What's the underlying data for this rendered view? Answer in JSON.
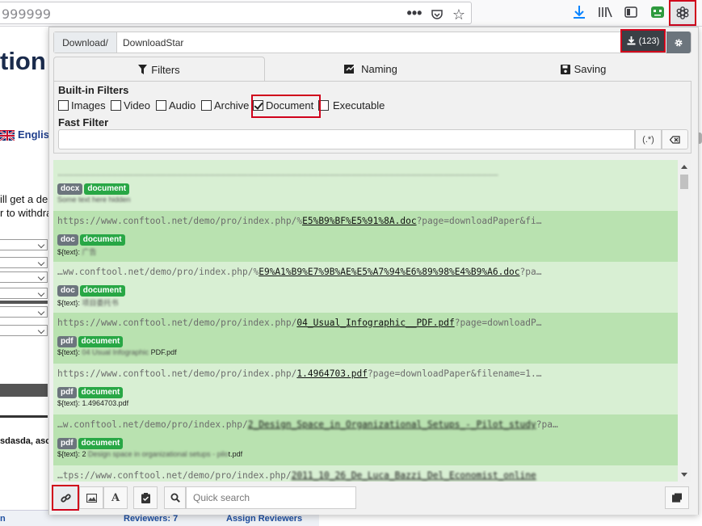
{
  "browser": {
    "url_partial": "999999",
    "icons": [
      "more-dots-icon",
      "pocket-icon",
      "bookmark-star-icon",
      "download-arrow-icon",
      "library-icon",
      "sidebar-icon",
      "addon-green-icon",
      "extension-gear-icon"
    ]
  },
  "background_page": {
    "heading_fragment": "tion",
    "language": "Englis",
    "text_line1": "ill get a de",
    "text_line2": "r to withdra",
    "user_fragment": "sdasda, asc",
    "reviewers_label": "Reviewers: 7",
    "assign_label": "Assign Reviewers",
    "link_fragment": "n"
  },
  "popup": {
    "path_prefix": "Download/",
    "path_value": "DownloadStar",
    "download_count": "(123)",
    "tabs": [
      {
        "label": "Filters",
        "icon": "filter-icon",
        "active": true
      },
      {
        "label": "Naming",
        "icon": "signature-icon",
        "active": false
      },
      {
        "label": "Saving",
        "icon": "floppy-disk-icon",
        "active": false
      }
    ],
    "builtin_filters_title": "Built-in Filters",
    "filters": [
      {
        "label": "Images",
        "checked": false
      },
      {
        "label": "Video",
        "checked": false
      },
      {
        "label": "Audio",
        "checked": false
      },
      {
        "label": "Archive",
        "checked": false
      },
      {
        "label": "Document",
        "checked": true
      },
      {
        "label": "Executable",
        "checked": false
      }
    ],
    "fast_filter_title": "Fast Filter",
    "fast_filter_value": "",
    "regex_label": "(.*)",
    "items": [
      {
        "url_prefix": "",
        "file": "",
        "url_suffix": "",
        "url_blurred": "_________________________________________________________________________________",
        "type": "docx",
        "category": "document",
        "text_prefix": "",
        "text_blurred": "Some text here hidden"
      },
      {
        "url_prefix": "https://www.conftool.net/demo/pro/index.php/%",
        "file": "E5%B9%BF%E5%91%8A.doc",
        "url_suffix": "?page=downloadPaper&fi…",
        "url_blurred": "",
        "type": "doc",
        "category": "document",
        "text_prefix": "${text}: ",
        "text_blurred": "广告"
      },
      {
        "url_prefix": "…ww.conftool.net/demo/pro/index.php/%",
        "file": "E9%A1%B9%E7%9B%AE%E5%A7%94%E6%89%98%E4%B9%A6.doc",
        "url_suffix": "?pa…",
        "url_blurred": "",
        "type": "doc",
        "category": "document",
        "text_prefix": "${text}: ",
        "text_blurred": "项目委托书"
      },
      {
        "url_prefix": "https://www.conftool.net/demo/pro/index.php/",
        "file": "04_Usual_Infographic__PDF.pdf",
        "url_suffix": "?page=downloadP…",
        "url_blurred": "",
        "type": "pdf",
        "category": "document",
        "text_prefix": "${text}: ",
        "text_blurred": "04 Usual Infographic ",
        "text_suffix": "PDF.pdf"
      },
      {
        "url_prefix": "https://www.conftool.net/demo/pro/index.php/",
        "file": "1.4964703.pdf",
        "url_suffix": "?page=downloadPaper&filename=1.…",
        "url_blurred": "",
        "type": "pdf",
        "category": "document",
        "text_prefix": "${text}: ",
        "text_blurred": "",
        "text_suffix": "1.4964703.pdf"
      },
      {
        "url_prefix": "…w.conftool.net/demo/pro/index.php/",
        "file": "",
        "url_suffix": "?pa…",
        "url_blurred": "2_Design_Space_in_Organizational_Setups_-_Pilot_study",
        "type": "pdf",
        "category": "document",
        "text_prefix": "${text}: 2 ",
        "text_blurred": "Design space in organizational setups - pilo",
        "text_suffix": "t.pdf"
      },
      {
        "url_prefix": "…tps://www.conftool.net/demo/pro/index.php/",
        "file": "",
        "url_suffix": "",
        "url_blurred": "2011_10_26_De_Luca_Bazzi_Del_Economist_online",
        "type": "",
        "category": "",
        "text_prefix": "",
        "text_blurred": ""
      }
    ],
    "quick_search_placeholder": "Quick search",
    "colors": {
      "highlight_red": "#d0021b",
      "row_light": "#d8efd3",
      "row_dark": "#b9e2b0",
      "badge_green": "#28a745",
      "badge_gray": "#6c757d",
      "dark_button": "#3a4046"
    }
  }
}
